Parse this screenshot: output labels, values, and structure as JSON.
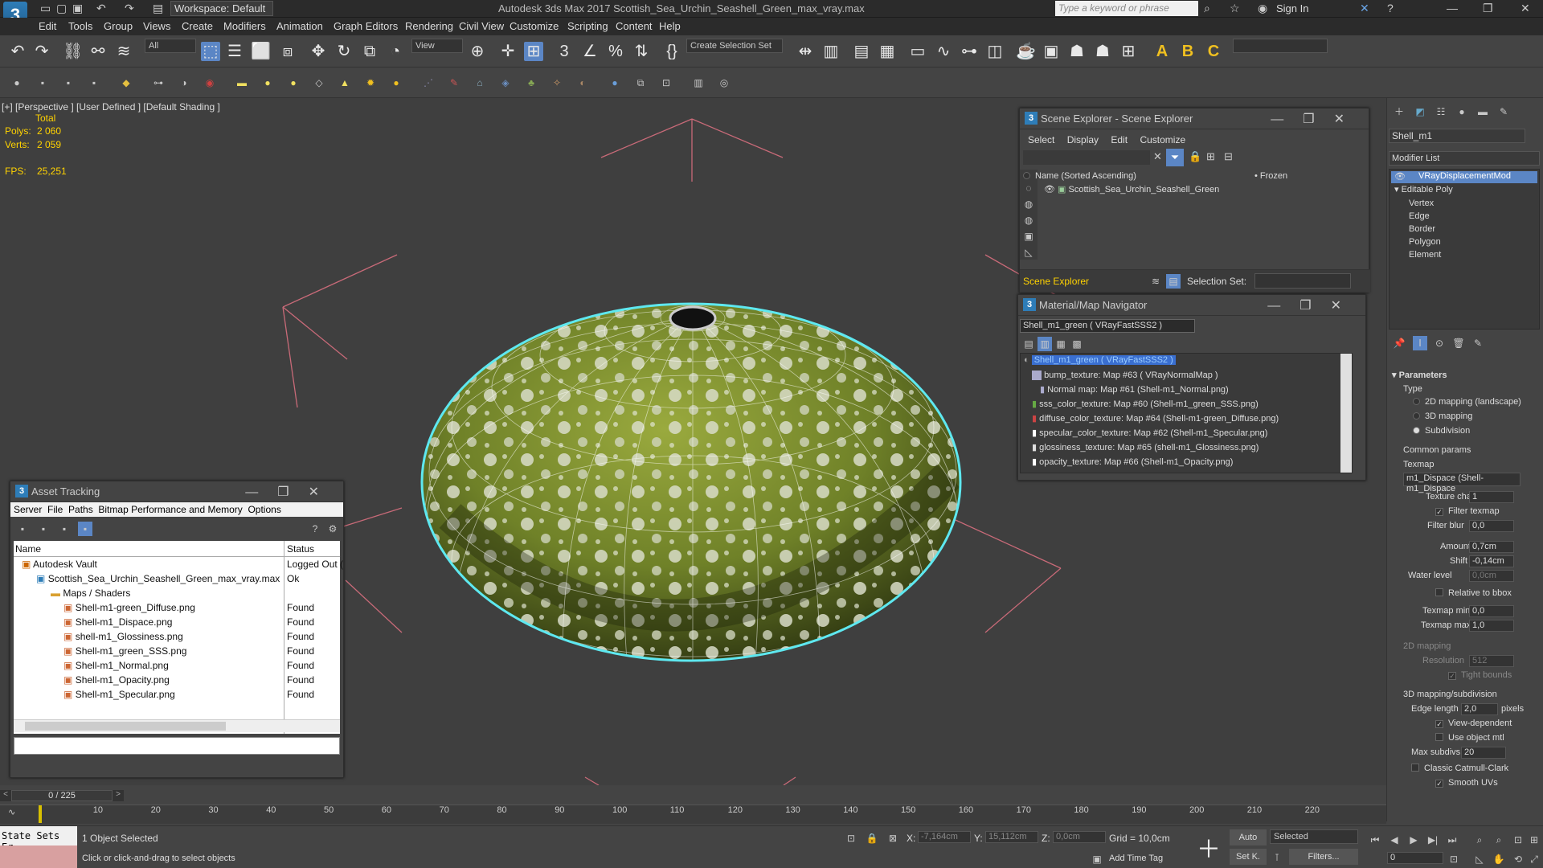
{
  "titlebar": {
    "workspace": "Workspace: Default",
    "title": "Autodesk 3ds Max 2017    Scottish_Sea_Urchin_Seashell_Green_max_vray.max",
    "search_placeholder": "Type a keyword or phrase",
    "sign_in": "Sign In"
  },
  "menu": [
    "Edit",
    "Tools",
    "Group",
    "Views",
    "Create",
    "Modifiers",
    "Animation",
    "Graph Editors",
    "Rendering",
    "Civil View",
    "Customize",
    "Scripting",
    "Content",
    "Help"
  ],
  "toolbar": {
    "filter": "All",
    "view": "View",
    "selection_set": "Create Selection Set"
  },
  "viewport": {
    "label": "[+] [Perspective ] [User Defined ] [Default Shading ]",
    "total": "Total",
    "polys_label": "Polys:",
    "polys": "2 060",
    "verts_label": "Verts:",
    "verts": "2 059",
    "fps_label": "FPS:",
    "fps": "25,251"
  },
  "scene_explorer": {
    "title": "Scene Explorer - Scene Explorer",
    "menu": [
      "Select",
      "Display",
      "Edit",
      "Customize"
    ],
    "col_name": "Name (Sorted Ascending)",
    "col_frozen": "• Frozen",
    "item": "Scottish_Sea_Urchin_Seashell_Green",
    "footer": "Scene Explorer",
    "selection_set": "Selection Set:"
  },
  "material_nav": {
    "title": "Material/Map Navigator",
    "current": "Shell_m1_green  ( VRayFastSSS2 )",
    "items": [
      "Shell_m1_green  ( VRayFastSSS2 )",
      "bump_texture: Map #63  ( VRayNormalMap )",
      "Normal map: Map #61 (Shell-m1_Normal.png)",
      "sss_color_texture: Map #60 (Shell-m1_green_SSS.png)",
      "diffuse_color_texture: Map #64 (Shell-m1-green_Diffuse.png)",
      "specular_color_texture: Map #62 (Shell-m1_Specular.png)",
      "glossiness_texture: Map #65 (shell-m1_Glossiness.png)",
      "opacity_texture: Map #66 (Shell-m1_Opacity.png)"
    ]
  },
  "asset_tracking": {
    "title": "Asset Tracking",
    "menu": [
      "Server",
      "File",
      "Paths",
      "Bitmap Performance and Memory",
      "Options"
    ],
    "col_name": "Name",
    "col_status": "Status",
    "rows": [
      {
        "name": "Autodesk Vault",
        "status": "Logged Out ("
      },
      {
        "name": "Scottish_Sea_Urchin_Seashell_Green_max_vray.max",
        "status": "Ok"
      },
      {
        "name": "Maps / Shaders",
        "status": ""
      },
      {
        "name": "Shell-m1-green_Diffuse.png",
        "status": "Found"
      },
      {
        "name": "Shell-m1_Dispace.png",
        "status": "Found"
      },
      {
        "name": "shell-m1_Glossiness.png",
        "status": "Found"
      },
      {
        "name": "Shell-m1_green_SSS.png",
        "status": "Found"
      },
      {
        "name": "Shell-m1_Normal.png",
        "status": "Found"
      },
      {
        "name": "Shell-m1_Opacity.png",
        "status": "Found"
      },
      {
        "name": "Shell-m1_Specular.png",
        "status": "Found"
      }
    ]
  },
  "command_panel": {
    "object_name": "Shell_m1",
    "modifier_list": "Modifier List",
    "stack": [
      "VRayDisplacementMod",
      "Editable Poly",
      "Vertex",
      "Edge",
      "Border",
      "Polygon",
      "Element"
    ],
    "parameters": "Parameters",
    "type_label": "Type",
    "type_options": [
      "2D mapping (landscape)",
      "3D mapping",
      "Subdivision"
    ],
    "common_params": "Common params",
    "texmap_label": "Texmap",
    "texmap": "m1_Dispace (Shell-m1_Dispace",
    "texture_chan_label": "Texture chan",
    "texture_chan": "1",
    "filter_texmap": "Filter texmap",
    "filter_blur_label": "Filter blur",
    "filter_blur": "0,0",
    "amount_label": "Amount",
    "amount": "0,7cm",
    "shift_label": "Shift",
    "shift": "-0,14cm",
    "water_level_label": "Water level",
    "water_level": "0,0cm",
    "relative_bbox": "Relative to bbox",
    "texmap_min_label": "Texmap min",
    "texmap_min": "0,0",
    "texmap_max_label": "Texmap max",
    "texmap_max": "1,0",
    "mapping_2d": "2D mapping",
    "resolution_label": "Resolution",
    "resolution": "512",
    "tight_bounds": "Tight bounds",
    "mapping_3d": "3D mapping/subdivision",
    "edge_length_label": "Edge length",
    "edge_length": "2,0",
    "pixels": "pixels",
    "view_dependent": "View-dependent",
    "use_object_mtl": "Use object mtl",
    "max_subdivs_label": "Max subdivs",
    "max_subdivs": "20",
    "classic_cc": "Classic Catmull-Clark",
    "smooth_uvs": "Smooth UVs"
  },
  "timeline": {
    "frame": "0 / 225",
    "ticks": [
      "10",
      "20",
      "30",
      "40",
      "50",
      "60",
      "70",
      "80",
      "90",
      "100",
      "110",
      "120",
      "130",
      "140",
      "150",
      "160",
      "170",
      "180",
      "190",
      "200",
      "210",
      "220"
    ]
  },
  "status": {
    "state_sets": "State Sets Er",
    "selected": "1 Object Selected",
    "hint": "Click or click-and-drag to select objects",
    "x": "-7,164cm",
    "y": "15,112cm",
    "z": "0,0cm",
    "grid": "Grid = 10,0cm",
    "add_time_tag": "Add Time Tag",
    "auto": "Auto",
    "set_k": "Set K.",
    "selected_dd": "Selected",
    "filters": "Filters...",
    "frame_value": "0"
  }
}
